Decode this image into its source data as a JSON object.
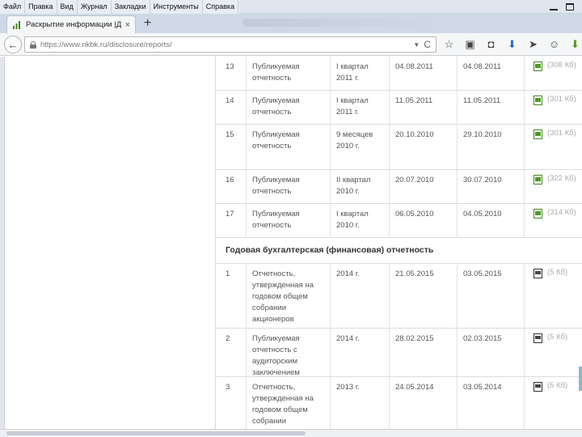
{
  "menu": {
    "items": [
      "Файл",
      "Правка",
      "Вид",
      "Журнал",
      "Закладки",
      "Инструменты",
      "Справка"
    ]
  },
  "tab": {
    "title": "Раскрытие информации |Д...",
    "close": "×",
    "new_tab": "+"
  },
  "nav": {
    "back": "←",
    "url": "https://www.nkbk.ru/disclosure/reports/",
    "dropdown": "▼",
    "reload": "C"
  },
  "icons": {
    "toolbar": [
      "star-icon",
      "library-icon",
      "pocket-icon",
      "download-icon",
      "send-icon",
      "smiley-icon",
      "extension-icon"
    ]
  },
  "table": {
    "rows_top": [
      {
        "num": "13",
        "title": "Публикуемая отчетность",
        "period": "I квартал 2011 г.",
        "date1": "04.08.2011",
        "date2": "04.08.2011",
        "size": "(308 Кб)",
        "type": "excel"
      },
      {
        "num": "14",
        "title": "Публикуемая отчетность",
        "period": "I квартал 2011 г.",
        "date1": "11.05.2011",
        "date2": "11.05.2011",
        "size": "(301 Кб)",
        "type": "excel"
      },
      {
        "num": "15",
        "title": "Публикуемая отчетность",
        "period": "9 месяцев 2010 г.",
        "date1": "20.10.2010",
        "date2": "29.10.2010",
        "size": "(301 Кб)",
        "type": "excel"
      },
      {
        "num": "16",
        "title": "Публикуемая отчетность",
        "period": "II квартал 2010 г.",
        "date1": "20.07.2010",
        "date2": "30.07.2010",
        "size": "(322 Кб)",
        "type": "excel"
      },
      {
        "num": "17",
        "title": "Публикуемая отчетность",
        "period": "I квартал 2010 г.",
        "date1": "06.05.2010",
        "date2": "04.05.2010",
        "size": "(314 Кб)",
        "type": "excel"
      }
    ],
    "section_title": "Годовая бухгалтерская (финансовая) отчетность",
    "rows_bottom": [
      {
        "num": "1",
        "title": "Отчетность, утвержденная на годовом общем собрании акционеров",
        "period": "2014 г.",
        "date1": "21.05.2015",
        "date2": "03.05.2015",
        "size": "(5 Кб)",
        "type": "word"
      },
      {
        "num": "2",
        "title": "Публикуемая отчетность с аудиторским заключением",
        "period": "2014 г.",
        "date1": "28.02.2015",
        "date2": "02.03.2015",
        "size": "(5 Кб)",
        "type": "word"
      },
      {
        "num": "3",
        "title": "Отчетность, утвержденная на годовом общем собрании",
        "period": "2013 г.",
        "date1": "24.05.2014",
        "date2": "03.05.2014",
        "size": "(5 Кб)",
        "type": "word"
      }
    ]
  }
}
